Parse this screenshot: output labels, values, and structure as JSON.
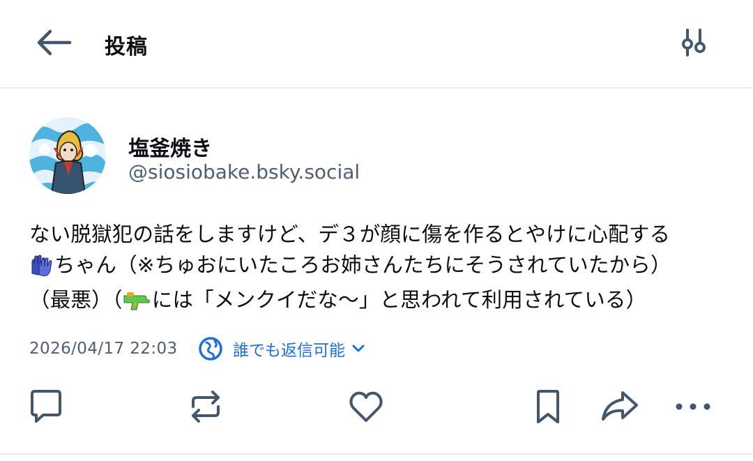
{
  "header": {
    "title": "投稿",
    "back_icon": "arrow-left-icon",
    "settings_icon": "sliders-icon"
  },
  "post": {
    "author": {
      "display_name": "塩釜焼き",
      "handle": "@siosiobake.bsky.social"
    },
    "text_lines": [
      "ない脱獄犯の話をしますけど、デ３が顔に傷を作るとやけに心配する",
      "ちゃん（※ちゅおにいたころお姉さんたちにそうされていたから）",
      "（最悪）（",
      "には「メンクイだな～」と思われて利用されている）"
    ],
    "emoji": [
      "gloves-emoji",
      "water-gun-emoji"
    ],
    "timestamp": "2026/04/17 22:03",
    "reply_setting": "誰でも返信可能"
  },
  "actions": [
    "reply-icon",
    "repost-icon",
    "like-icon",
    "bookmark-icon",
    "share-icon",
    "more-icon"
  ],
  "colors": {
    "text": "#0b0f14",
    "muted": "#4e5f73",
    "accent": "#1b6fe0",
    "icon": "#42576c",
    "divider": "#e9edf1"
  }
}
